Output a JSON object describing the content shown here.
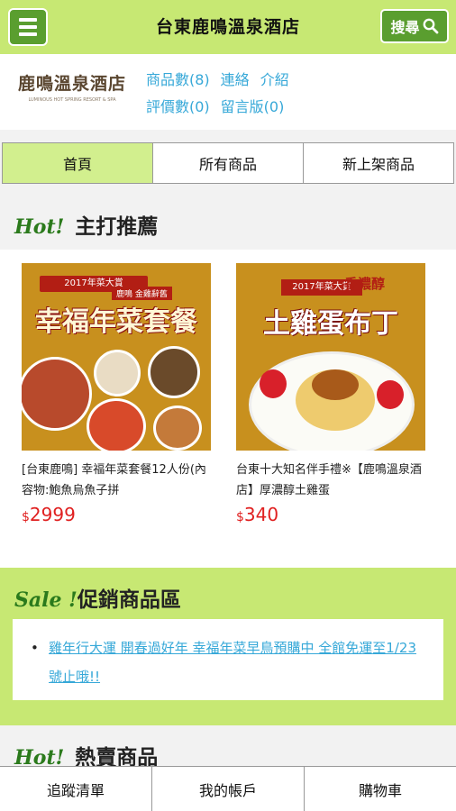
{
  "header": {
    "title": "台東鹿鳴溫泉酒店",
    "search_label": "搜尋",
    "menu_icon": "hamburger-menu-icon",
    "search_icon": "search-icon",
    "bar_color": "#c7e873",
    "button_color": "#5a9e2f"
  },
  "store": {
    "logo_text": "鹿鳴溫泉酒店",
    "logo_subtext": "LUMINOUS HOT SPRING RESORT & SPA",
    "links": {
      "product_count": "商品數(8)",
      "contact": "連絡",
      "intro": "介紹",
      "review_count": "評價數(0)",
      "guestbook": "留言版(0)"
    }
  },
  "tabs": [
    {
      "label": "首頁",
      "active": true
    },
    {
      "label": "所有商品",
      "active": false
    },
    {
      "label": "新上架商品",
      "active": false
    }
  ],
  "featured": {
    "hot_label": "Hot!",
    "title": "主打推薦",
    "products": [
      {
        "image": {
          "banner": "2017年菜大賞",
          "tag": "鹿鳴 金雞辭舊",
          "headline": "幸福年菜套餐"
        },
        "caption": "[台東鹿鳴] 幸福年菜套餐12人份(內容物:鮑魚烏魚子拼",
        "currency": "$",
        "price": "2999"
      },
      {
        "image": {
          "banner": "2017年菜大賞",
          "tag": "香濃醇",
          "headline": "土雞蛋布丁"
        },
        "caption": "台東十大知名伴手禮※【鹿鳴溫泉酒店】厚濃醇土雞蛋",
        "currency": "$",
        "price": "340"
      }
    ]
  },
  "sale": {
    "sale_label": "Sale !",
    "title": "促銷商品區",
    "items": [
      "雞年行大運 開春過好年 幸福年菜早鳥預購中 全館免運至1/23號止哦!!"
    ]
  },
  "hot_sellers": {
    "hot_label": "Hot!",
    "title": "熱賣商品"
  },
  "bottom_nav": {
    "tracking": "追蹤清單",
    "account": "我的帳戶",
    "cart": "購物車"
  },
  "colors": {
    "accent_green": "#c7e873",
    "active_tab": "#d2ef8e",
    "link_blue": "#36a8d8",
    "price_red": "#e02020",
    "hot_green": "#2b7a1c"
  }
}
